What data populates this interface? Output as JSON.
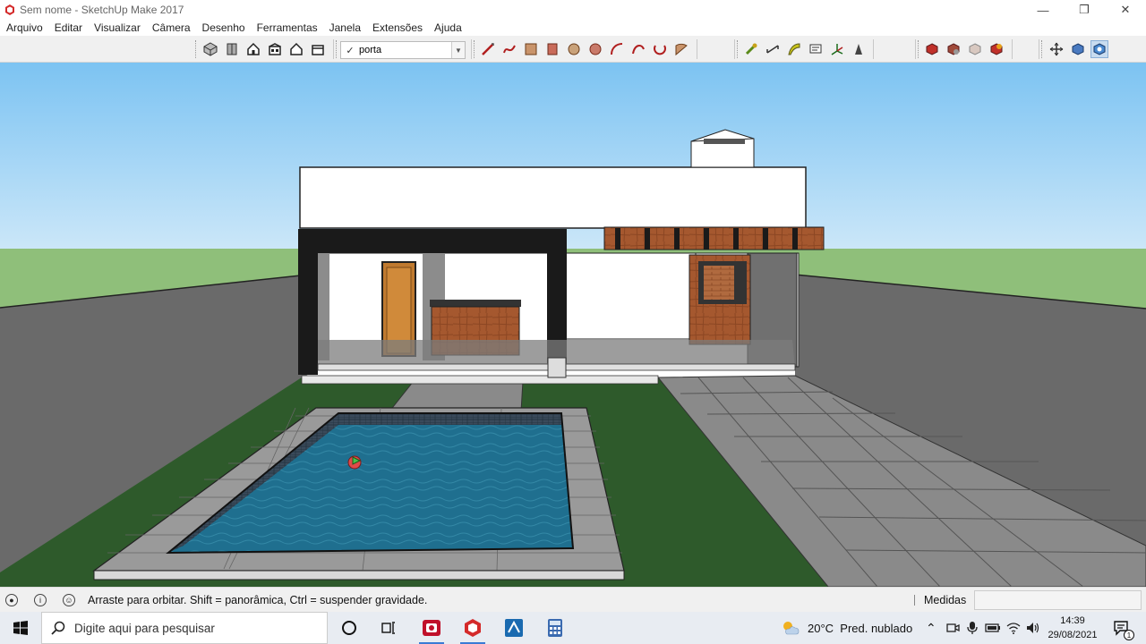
{
  "window": {
    "title": "Sem nome - SketchUp Make 2017",
    "controls": [
      "minimize-icon",
      "restore-icon",
      "close-icon"
    ]
  },
  "menu": [
    "Arquivo",
    "Editar",
    "Visualizar",
    "Câmera",
    "Desenho",
    "Ferramentas",
    "Janela",
    "Extensões",
    "Ajuda"
  ],
  "scene_select": {
    "value": "porta"
  },
  "toolbar_groups": {
    "views": [
      "iso-view-icon",
      "top-view-icon",
      "front-view-icon",
      "right-view-icon",
      "back-view-icon",
      "left-view-icon"
    ],
    "drawing": [
      "line-icon",
      "freehand-icon",
      "rectangle-icon",
      "rotated-rectangle-icon",
      "circle-icon",
      "polygon-icon",
      "arc-icon",
      "two-point-arc-icon",
      "three-point-arc-icon",
      "pie-icon"
    ],
    "construction": [
      "tape-measure-icon",
      "dimension-icon",
      "protractor-icon",
      "text-icon",
      "axes-icon",
      "3d-text-icon"
    ],
    "warehouse": [
      "3d-warehouse-icon",
      "share-model-icon",
      "extension-warehouse-icon",
      "layout-icon"
    ],
    "navigation": [
      "orbit-icon",
      "pan-icon",
      "zoom-icon"
    ]
  },
  "status": {
    "message": "Arraste para orbitar. Shift = panorâmica, Ctrl = suspender gravidade.",
    "measurements_label": "Medidas",
    "measurements_value": ""
  },
  "taskbar": {
    "search_placeholder": "Digite aqui para pesquisar",
    "weather": "20°C  Pred. nublado",
    "time": "14:39",
    "date": "29/08/2021",
    "notification_count": "1"
  },
  "colors": {
    "sky_top": "#7cc3f2",
    "sky_bottom": "#e6f3fb",
    "grass_far": "#8fbf7a",
    "lawn": "#2e5a2b",
    "wall": "#6a6a6a",
    "pool_water": "#1f6f8f",
    "wood": "#a5582f",
    "accent": "#3a7bd5"
  }
}
